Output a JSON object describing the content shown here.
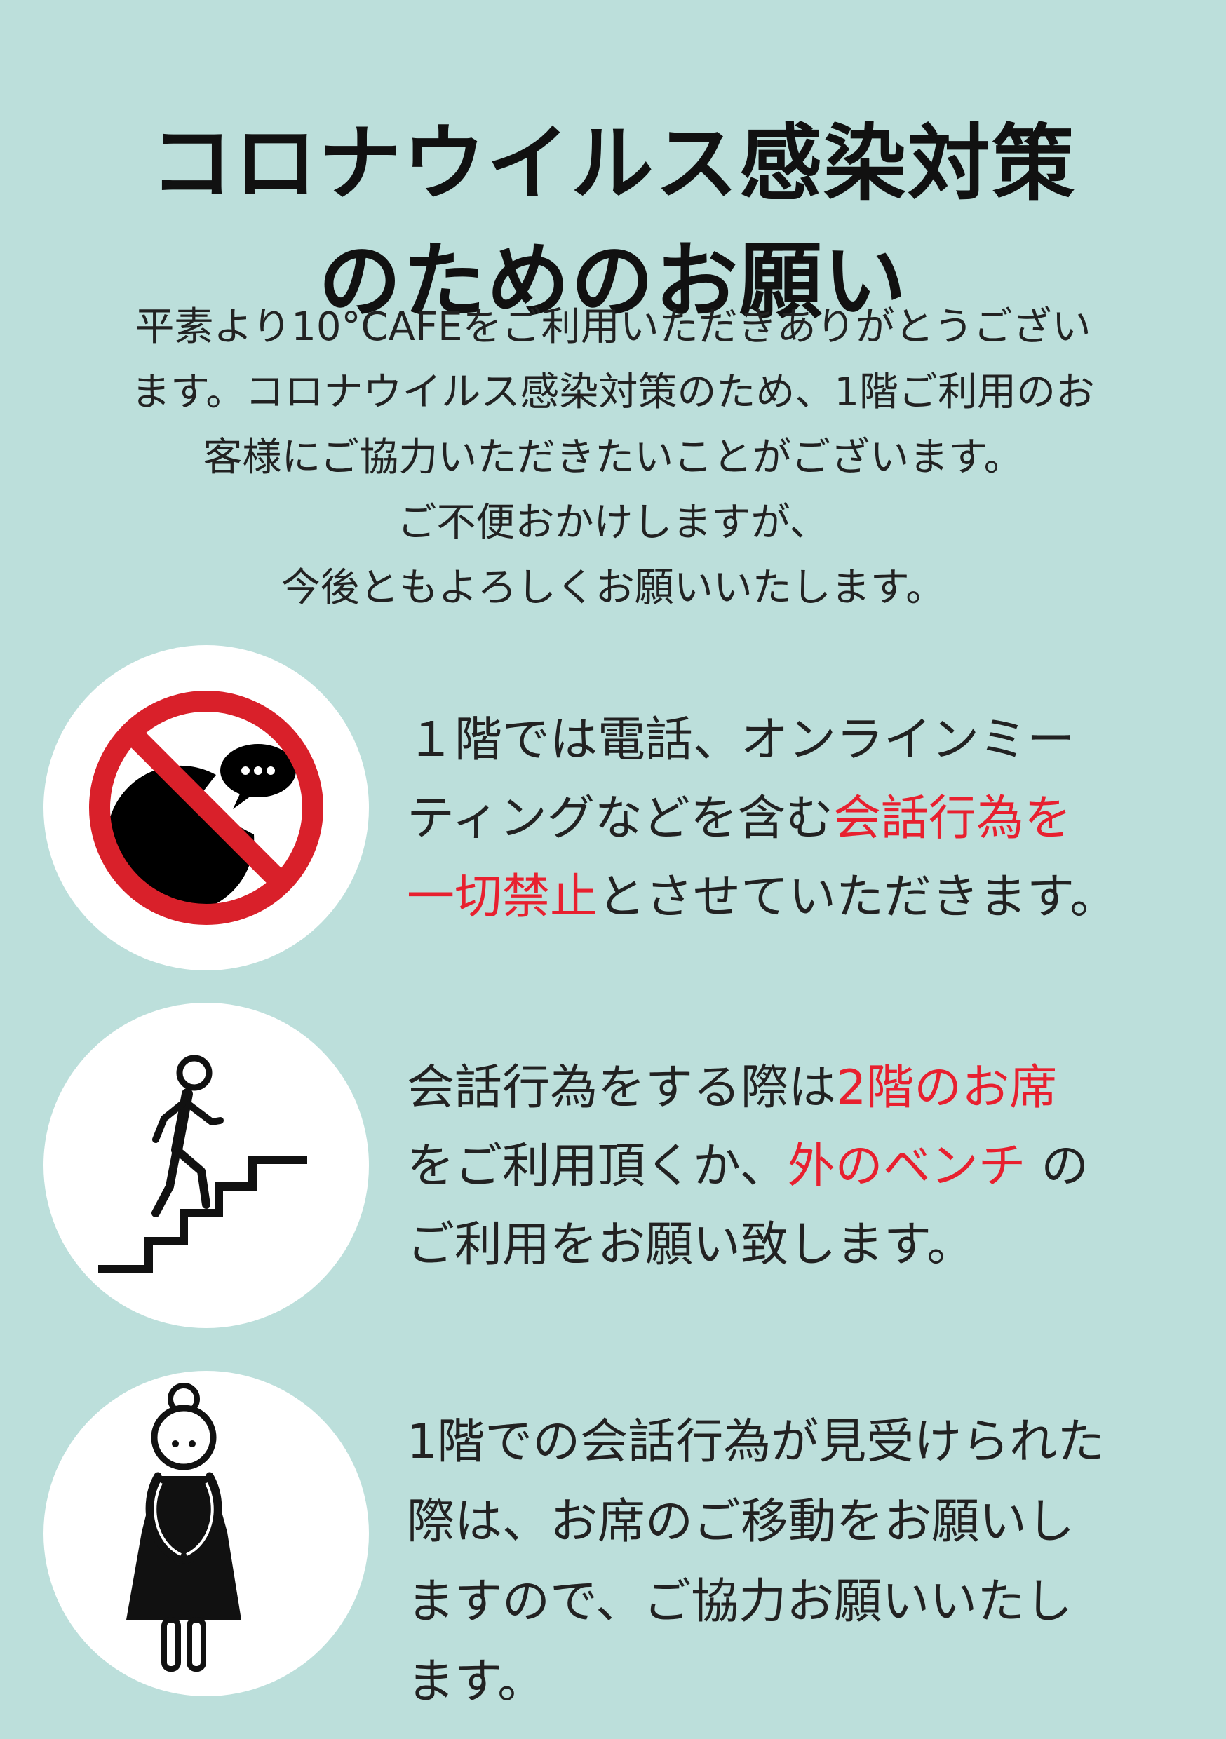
{
  "title": {
    "line1": "コロナウイルス感染対策",
    "line2": "のためのお願い"
  },
  "intro": {
    "lines": [
      "平素より10°CAFEをご利用いただきありがとうござい",
      "ます。コロナウイルス感染対策のため、1階ご利用のお",
      "客様にご協力いただきたいことがございます。",
      "ご不便おかけしますが、",
      "今後ともよろしくお願いいたします。"
    ]
  },
  "items": [
    {
      "icon": "no-talking-icon",
      "lines": [
        [
          {
            "text": "１階では電話、オンラインミー",
            "red": false
          }
        ],
        [
          {
            "text": "ティングなどを含む",
            "red": false
          },
          {
            "text": "会話行為を",
            "red": true
          }
        ],
        [
          {
            "text": "一切禁止",
            "red": true
          },
          {
            "text": "とさせていただきます。",
            "red": false
          }
        ]
      ]
    },
    {
      "icon": "stairs-walker-icon",
      "lines": [
        [
          {
            "text": "会話行為をする際は",
            "red": false
          },
          {
            "text": "2階のお席",
            "red": true
          }
        ],
        [
          {
            "text": "をご利用頂くか、",
            "red": false
          },
          {
            "text": "外のベンチ",
            "red": true
          },
          {
            "text": " の",
            "red": false
          }
        ],
        [
          {
            "text": "ご利用をお願い致します。",
            "red": false
          }
        ]
      ]
    },
    {
      "icon": "bowing-staff-icon",
      "lines": [
        [
          {
            "text": "1階での会話行為が見受けられた",
            "red": false
          }
        ],
        [
          {
            "text": "際は、お席のご移動をお願いし",
            "red": false
          }
        ],
        [
          {
            "text": "ますので、ご協力お願いいたし",
            "red": false
          }
        ],
        [
          {
            "text": "ます。",
            "red": false
          }
        ]
      ]
    }
  ],
  "colors": {
    "background": "#bcdfdb",
    "accent_red": "#e8202f",
    "text": "#222222"
  }
}
